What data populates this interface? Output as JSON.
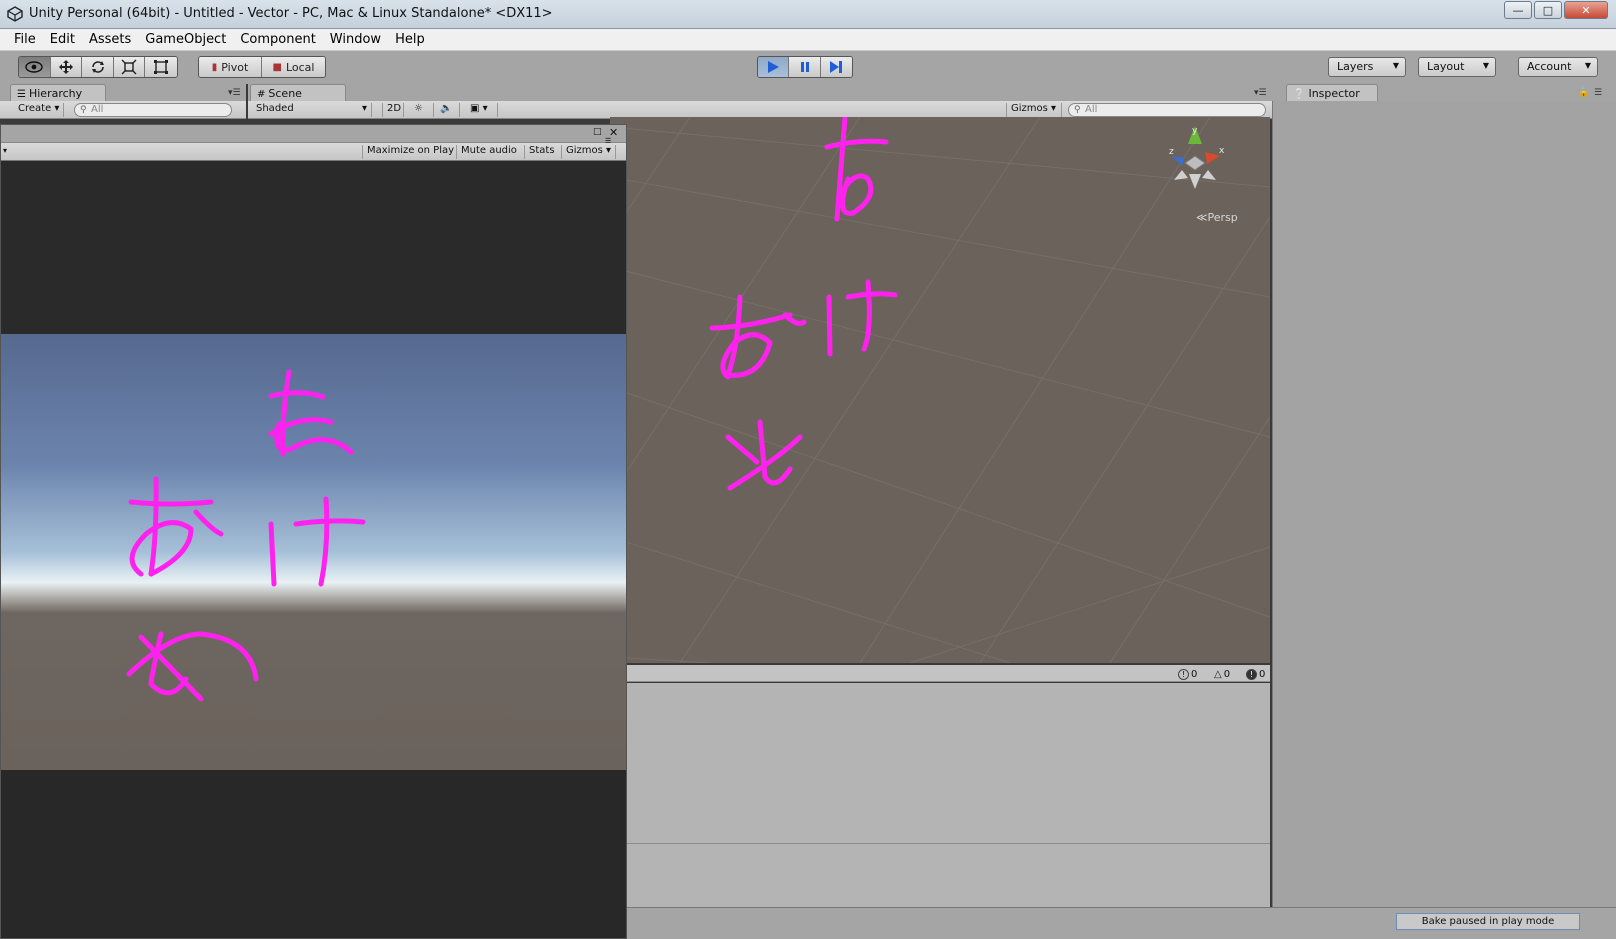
{
  "window": {
    "title": "Unity Personal (64bit) - Untitled - Vector - PC, Mac & Linux Standalone* <DX11>",
    "controls": [
      "minimize",
      "maximize",
      "close"
    ]
  },
  "menu": [
    "File",
    "Edit",
    "Assets",
    "GameObject",
    "Component",
    "Window",
    "Help"
  ],
  "toolbar": {
    "tools": [
      "hand-icon",
      "move-icon",
      "rotate-icon",
      "scale-icon",
      "rect-icon"
    ],
    "pivot_label": "Pivot",
    "local_label": "Local",
    "play_controls": [
      "play-icon",
      "pause-icon",
      "step-icon"
    ],
    "play_state": "playing",
    "layers_label": "Layers",
    "layout_label": "Layout",
    "account_label": "Account"
  },
  "hierarchy": {
    "tab_label": "Hierarchy",
    "create_label": "Create",
    "search_placeholder": "All"
  },
  "scene": {
    "tab_label": "Scene",
    "shading_label": "Shaded",
    "mode_2d_label": "2D",
    "gizmos_label": "Gizmos",
    "search_placeholder": "All",
    "persp_label": "Persp",
    "axis_labels": {
      "y": "y",
      "x": "x",
      "z": "z"
    }
  },
  "game": {
    "maximize_label": "Maximize on Play",
    "mute_label": "Mute audio",
    "stats_label": "Stats",
    "gizmos_label": "Gizmos"
  },
  "console": {
    "log_count": "0",
    "warning_count": "0",
    "error_count": "0"
  },
  "inspector": {
    "tab_label": "Inspector"
  },
  "status": {
    "message": "Bake paused in play mode"
  },
  "colors": {
    "stroke": "#ff22ee",
    "toolbar_bg": "#a5a5a5",
    "scene_ground": "#6a625b",
    "play_active": "#8fa9c8"
  }
}
